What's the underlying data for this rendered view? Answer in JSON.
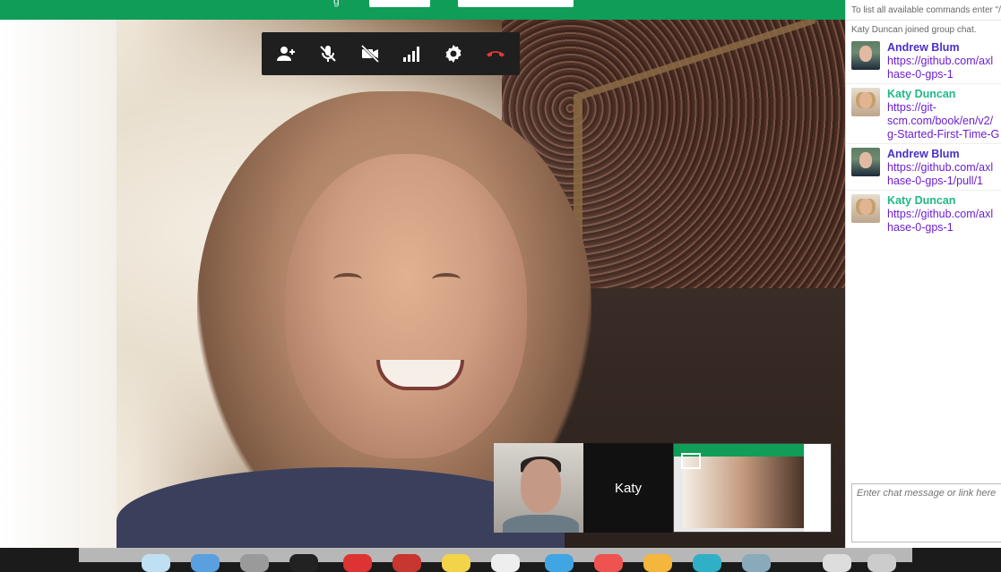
{
  "topbar": {
    "partial_text": "g"
  },
  "controls": {
    "invite_icon": "person-add-icon",
    "mic_icon": "mic-off-icon",
    "camera_icon": "videocam-off-icon",
    "bandwidth_icon": "signal-bars-icon",
    "settings_icon": "gear-icon",
    "hangup_icon": "phone-hangup-icon",
    "hangup_color": "#e53935"
  },
  "thumbnails": {
    "participant_name": "Katy"
  },
  "chat": {
    "system_lines": [
      "To list all available commands enter \"/?\"",
      "Katy Duncan joined group chat."
    ],
    "messages": [
      {
        "sender": "Andrew Blum",
        "lines": [
          "https://github.com/axl",
          "hase-0-gps-1"
        ]
      },
      {
        "sender": "Katy Duncan",
        "lines": [
          "https://git-",
          "scm.com/book/en/v2/",
          "g-Started-First-Time-G"
        ]
      },
      {
        "sender": "Andrew Blum",
        "lines": [
          "https://github.com/axl",
          "hase-0-gps-1/pull/1"
        ]
      },
      {
        "sender": "Katy Duncan",
        "lines": [
          "https://github.com/axl",
          "hase-0-gps-1"
        ]
      }
    ],
    "input_placeholder": "Enter chat message or link here"
  },
  "colors": {
    "topbar_green": "#0f9d58",
    "andrew_name": "#4a2fc9",
    "katy_name": "#1fb886",
    "link": "#6b1fd1"
  }
}
